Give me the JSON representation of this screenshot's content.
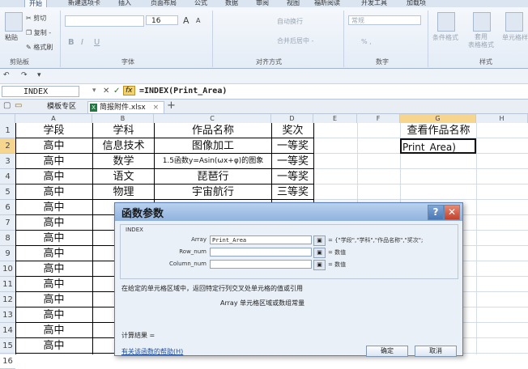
{
  "ribbon": {
    "tabs": [
      "开始",
      "新建选项卡",
      "插入",
      "页面布局",
      "公式",
      "数据",
      "审阅",
      "视图",
      "福昕阅读",
      "开发工具",
      "加载项"
    ],
    "clipboard": {
      "paste": "粘贴",
      "cut": "剪切",
      "copy": "复制 -",
      "format_painter": "格式刷",
      "group_label": "剪贴板"
    },
    "font": {
      "size": "16",
      "grow": "A",
      "shrink": "A",
      "bold": "B",
      "italic": "I",
      "underline": "U",
      "group_label": "字体"
    },
    "alignment": {
      "wrap": "自动换行",
      "merge": "合并后居中 -",
      "group_label": "对齐方式"
    },
    "number": {
      "format": "常规",
      "percent": "% ,",
      "group_label": "数字"
    },
    "styles": {
      "conditional": "条件格式",
      "table": "套用\n表格格式",
      "cell": "单元格样",
      "group_label": "样式"
    }
  },
  "name_box": "INDEX",
  "formula_bar": {
    "cancel": "✕",
    "enter": "✓",
    "fx": "fx",
    "formula": "=INDEX(Print_Area)"
  },
  "doc_tabs": [
    {
      "label": "模板专区"
    },
    {
      "label": "简报附件.xlsx"
    }
  ],
  "sheet": {
    "columns": [
      "A",
      "B",
      "C",
      "D",
      "E",
      "F",
      "G",
      "H"
    ],
    "rows": [
      "1",
      "2",
      "3",
      "4",
      "5",
      "6",
      "7",
      "8",
      "9",
      "10",
      "11",
      "12",
      "13",
      "14",
      "15",
      "16"
    ],
    "header_row": {
      "A": "学段",
      "B": "学科",
      "C": "作品名称",
      "D": "奖次",
      "G": "查看作品名称"
    },
    "data_rows": [
      {
        "A": "高中",
        "B": "信息技术",
        "C": "图像加工",
        "D": "一等奖"
      },
      {
        "A": "高中",
        "B": "数学",
        "C": "1.5函数y=Asin(ωx+φ)的图象",
        "D": "一等奖"
      },
      {
        "A": "高中",
        "B": "语文",
        "C": "琵琶行",
        "D": "一等奖"
      },
      {
        "A": "高中",
        "B": "物理",
        "C": "宇宙航行",
        "D": "三等奖"
      },
      {
        "A": "高中"
      },
      {
        "A": "高中"
      },
      {
        "A": "高中"
      },
      {
        "A": "高中"
      },
      {
        "A": "高中"
      },
      {
        "A": "高中"
      },
      {
        "A": "高中"
      },
      {
        "A": "高中"
      },
      {
        "A": "高中"
      },
      {
        "A": "高中"
      },
      {
        "A": "高中"
      }
    ],
    "active_cell_text": "Print_Area)"
  },
  "dialog": {
    "title": "函数参数",
    "function_name": "INDEX",
    "args": [
      {
        "label": "Array",
        "value": "Print_Area",
        "result": "= {\"学段\",\"学科\",\"作品名称\",\"奖次\";"
      },
      {
        "label": "Row_num",
        "value": "",
        "result": "= 数值"
      },
      {
        "label": "Column_num",
        "value": "",
        "result": "= 数值"
      }
    ],
    "description": "在给定的单元格区域中，返回特定行列交叉处单元格的值或引用",
    "arg_description": "Array  单元格区域或数组常量",
    "calc_result": "计算结果 =",
    "help_link": "有关该函数的帮助(H)",
    "ok": "确定",
    "cancel": "取消"
  },
  "colors": {
    "accent": "#4c78b3",
    "selected_header": "#f6d58f",
    "close": "#c4412a"
  }
}
